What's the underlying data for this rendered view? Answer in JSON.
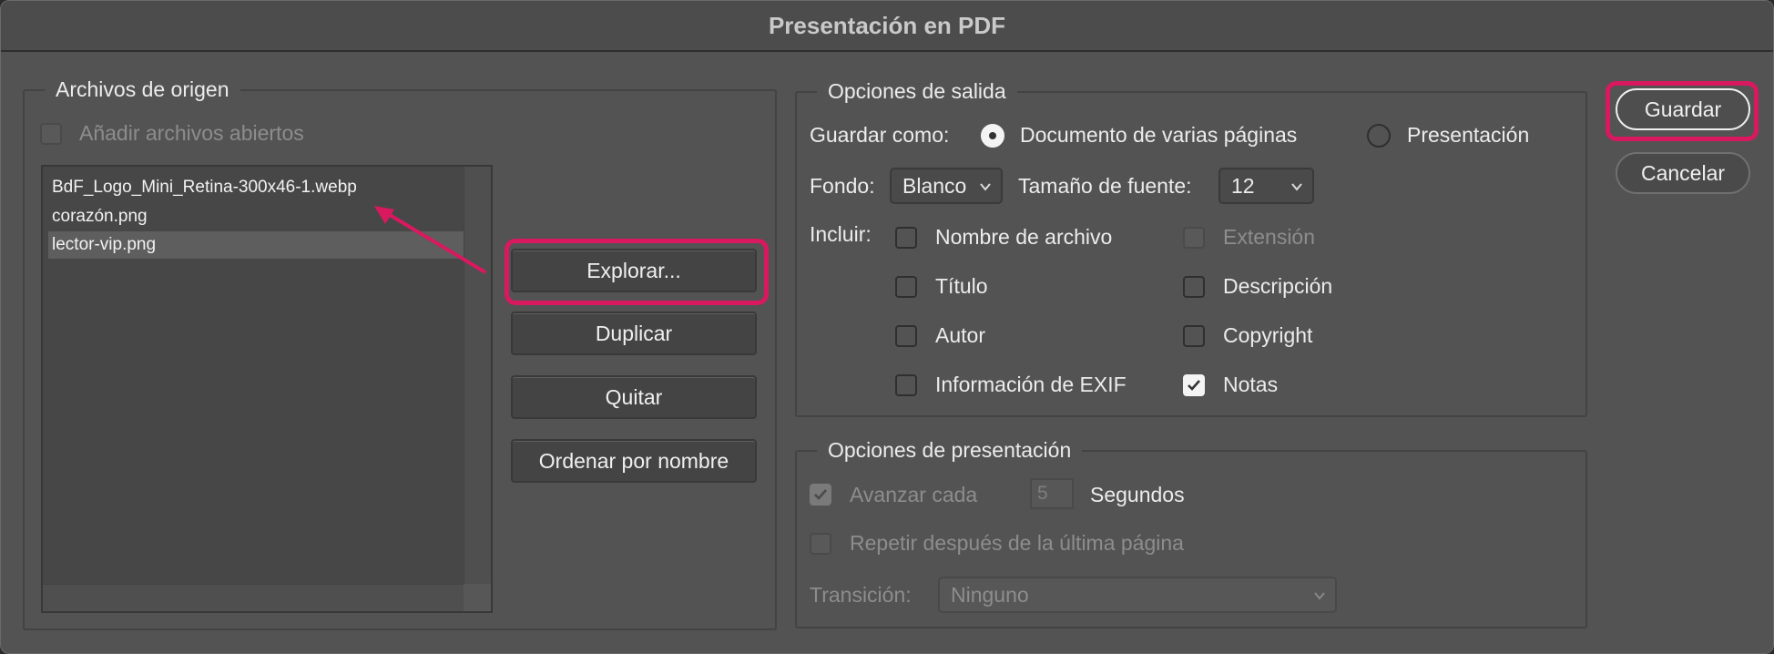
{
  "window": {
    "title": "Presentación en PDF"
  },
  "source_files": {
    "group_title": "Archivos de origen",
    "add_open_files_label": "Añadir archivos abiertos",
    "add_open_files_checked": false,
    "files": [
      "BdF_Logo_Mini_Retina-300x46-1.webp",
      "corazón.png",
      "lector-vip.png"
    ],
    "selected_index": 2,
    "buttons": {
      "browse": "Explorar...",
      "duplicate": "Duplicar",
      "remove": "Quitar",
      "sort_by_name": "Ordenar por nombre"
    }
  },
  "output_options": {
    "group_title": "Opciones de salida",
    "save_as_label": "Guardar como:",
    "save_as_options": [
      "Documento de varias páginas",
      "Presentación"
    ],
    "save_as_selected": "Documento de varias páginas",
    "background_label": "Fondo:",
    "background_value": "Blanco",
    "font_size_label": "Tamaño de fuente:",
    "font_size_value": "12",
    "include_label": "Incluir:",
    "include": {
      "filename": {
        "label": "Nombre de archivo",
        "checked": false
      },
      "extension": {
        "label": "Extensión",
        "checked": false,
        "enabled": false
      },
      "title": {
        "label": "Título",
        "checked": false
      },
      "description": {
        "label": "Descripción",
        "checked": false
      },
      "author": {
        "label": "Autor",
        "checked": false
      },
      "copyright": {
        "label": "Copyright",
        "checked": false
      },
      "exif": {
        "label": "Información de EXIF",
        "checked": false
      },
      "notes": {
        "label": "Notas",
        "checked": true
      }
    }
  },
  "presentation_options": {
    "group_title": "Opciones de presentación",
    "advance_label": "Avanzar cada",
    "advance_checked": true,
    "advance_seconds": "5",
    "seconds_label": "Segundos",
    "loop_label": "Repetir después de la última página",
    "loop_checked": false,
    "transition_label": "Transición:",
    "transition_value": "Ninguno"
  },
  "actions": {
    "save": "Guardar",
    "cancel": "Cancelar"
  },
  "colors": {
    "highlight": "#d9195f",
    "dialog_bg": "#535353"
  }
}
